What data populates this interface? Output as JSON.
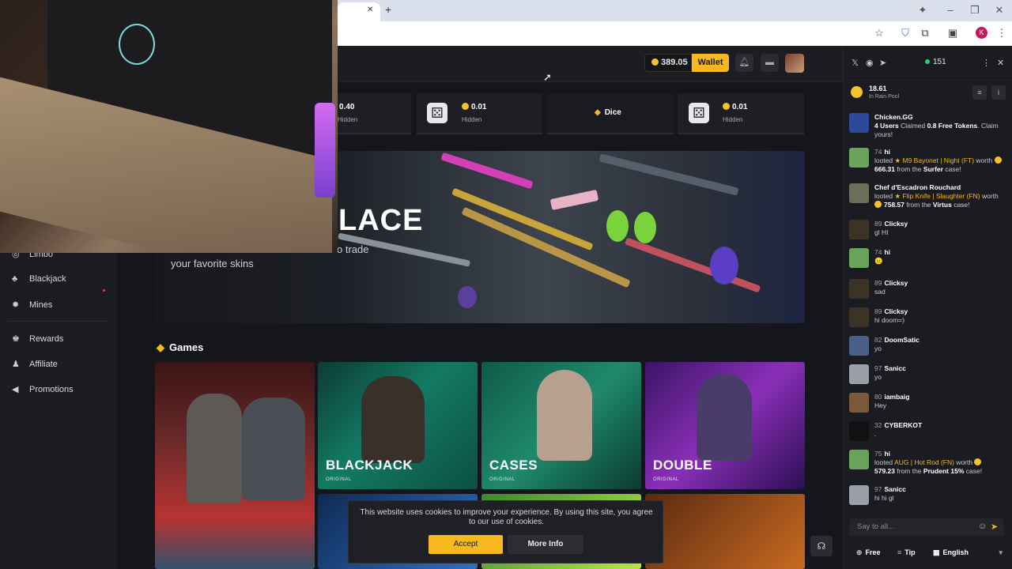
{
  "browser": {
    "tab_close": "✕",
    "tab_add": "+",
    "icons": [
      "star-icon",
      "shield-icon",
      "puzzle-icon",
      "media-icon"
    ],
    "profile_initial": "K"
  },
  "topbar": {
    "balance": "389.05",
    "wallet_label": "Wallet"
  },
  "sidebar": {
    "items": [
      {
        "label": "Limbo",
        "icon": "limbo-icon"
      },
      {
        "label": "Blackjack",
        "icon": "blackjack-icon"
      },
      {
        "label": "Mines",
        "icon": "mines-icon"
      },
      {
        "label": "Rewards",
        "icon": "rewards-icon"
      },
      {
        "label": "Affiliate",
        "icon": "affiliate-icon"
      },
      {
        "label": "Promotions",
        "icon": "promotions-icon"
      }
    ]
  },
  "bets": [
    {
      "amount": "0.40",
      "status": "Hidden"
    },
    {
      "amount": "0.01",
      "status": "Hidden"
    },
    {
      "game": "Dice"
    },
    {
      "amount": "0.01",
      "status": "Hidden"
    }
  ],
  "banner": {
    "title": "LACE",
    "sub1": "o trade",
    "sub2": "your favorite skins"
  },
  "games": {
    "heading": "Games",
    "cards": [
      {
        "name": "",
        "tag": ""
      },
      {
        "name": "BLACKJACK",
        "tag": "ORIGINAL"
      },
      {
        "name": "CASES",
        "tag": "ORIGINAL"
      },
      {
        "name": "DOUBLE",
        "tag": "ORIGINAL"
      }
    ]
  },
  "cookie": {
    "text": "This website uses cookies to improve your experience. By using this site, you agree to our use of cookies.",
    "accept": "Accept",
    "more": "More Info"
  },
  "chat": {
    "online": "151",
    "rain": {
      "amount": "18.61",
      "label": "In Rain Pool"
    },
    "messages": [
      {
        "user": "Chicken.GG",
        "level": "",
        "pre": "4 Users",
        "mid": " Claimed ",
        "hl": "0.8 Free Tokens",
        "post": ". Claim yours!"
      },
      {
        "user": "hi",
        "level": "74",
        "t1": "looted ",
        "item": "★ M9 Bayonet | Night (FT)",
        "t2": " worth ",
        "val": "666.31",
        "t3": " from the ",
        "case": "Surfer",
        "t4": " case!"
      },
      {
        "user": "Chef d'Escadron Rouchard",
        "level": "",
        "t1": "looted ",
        "item": "★ Flip Knife | Slaughter (FN)",
        "t2": " worth ",
        "val": "758.57",
        "t3": " from the ",
        "case": "Virtus",
        "t4": " case!"
      },
      {
        "user": "Clicksy",
        "level": "89",
        "text": "gl HI"
      },
      {
        "user": "hi",
        "level": "74",
        "text": "😐"
      },
      {
        "user": "Clicksy",
        "level": "89",
        "text": "sad"
      },
      {
        "user": "Clicksy",
        "level": "89",
        "text": "hi doom=)"
      },
      {
        "user": "DoomSatic",
        "level": "82",
        "text": "yo"
      },
      {
        "user": "Sanicc",
        "level": "97",
        "text": "yo"
      },
      {
        "user": "iambaig",
        "level": "80",
        "text": "Hey"
      },
      {
        "user": "CYBERKOT",
        "level": "32",
        "text": "."
      },
      {
        "user": "hi",
        "level": "75",
        "t1": "looted ",
        "item": "AUG | Hot Rod (FN)",
        "t2": " worth ",
        "val": "579.23",
        "t3": " from the ",
        "case": "Prudent 15%",
        "t4": " case!"
      },
      {
        "user": "Sanicc",
        "level": "97",
        "text": "hi hi gl"
      }
    ],
    "input_placeholder": "Say to all...",
    "footer": {
      "free": "Free",
      "tip": "Tip",
      "language": "English"
    }
  }
}
